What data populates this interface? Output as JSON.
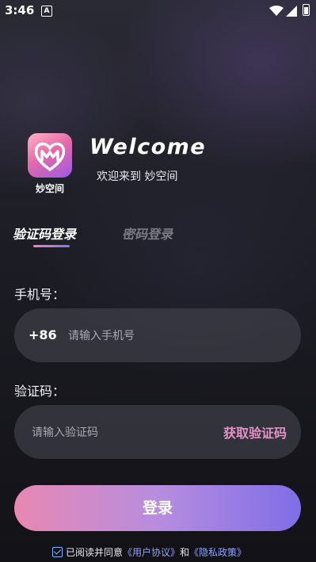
{
  "status_bar": {
    "time": "3:46",
    "notification_icon": "A",
    "icons": [
      "wifi-icon",
      "signal-icon",
      "battery-icon"
    ]
  },
  "branding": {
    "app_name": "妙空间",
    "welcome_title": "Welcome",
    "welcome_subtitle": "欢迎来到 妙空间"
  },
  "tabs": [
    {
      "label": "验证码登录",
      "active": true
    },
    {
      "label": "密码登录",
      "active": false
    }
  ],
  "form": {
    "phone_label": "手机号：",
    "country_code": "+86",
    "phone_placeholder": "请输入手机号",
    "code_label": "验证码：",
    "code_placeholder": "请输入验证码",
    "get_code_label": "获取验证码"
  },
  "login_button": "登录",
  "agreement": {
    "checked": true,
    "prefix": "已阅读并同意",
    "user_agreement": "《用户协议》",
    "conjunction": "和",
    "privacy_policy": "《隐私政策》"
  },
  "colors": {
    "accent_pink": "#e393c8",
    "accent_purple": "#7f6ee6",
    "link_blue": "#8fa3ff"
  }
}
